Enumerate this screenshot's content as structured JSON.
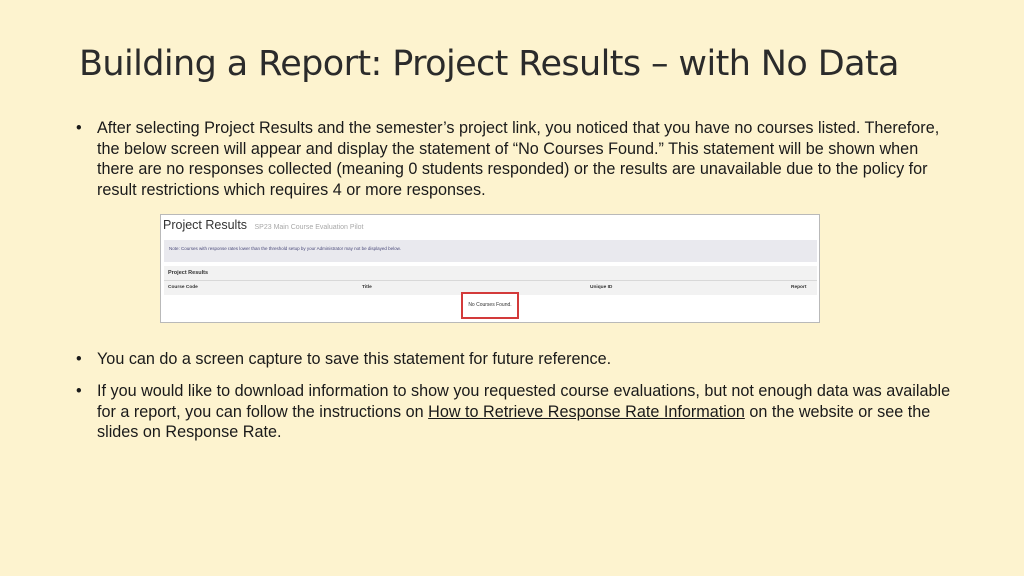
{
  "slide": {
    "title": "Building a Report:  Project Results – with No Data",
    "bullet_char": "•",
    "bullets": [
      {
        "text": "After selecting Project Results and the semester’s project link, you noticed that you have no courses listed. Therefore, the below screen will appear and display the statement of “No Courses Found.”  This statement will be shown when there are no responses collected (meaning 0 students responded) or the results are unavailable due to the policy for result restrictions which requires 4 or more responses."
      },
      {
        "text": "You can do a screen capture to save this statement for future reference."
      },
      {
        "text_before": "If you would like to download information to show you requested course evaluations, but not enough data was available for a report, you can follow the instructions on ",
        "link": "How to Retrieve Response Rate Information",
        "text_after": " on the website or see the slides on Response Rate."
      }
    ]
  },
  "screenshot": {
    "title": "Project Results",
    "subtitle": "SP23 Main Course Evaluation Pilot",
    "note": "Note: Courses with response rates lower than the threshold setup by your Administrator may not be displayed below.",
    "panel_title": "Project Results",
    "columns": [
      "Course Code",
      "Title",
      "Unique ID",
      "Report"
    ],
    "empty_message": "No Courses Found.",
    "highlight_color": "#d33a3a"
  }
}
